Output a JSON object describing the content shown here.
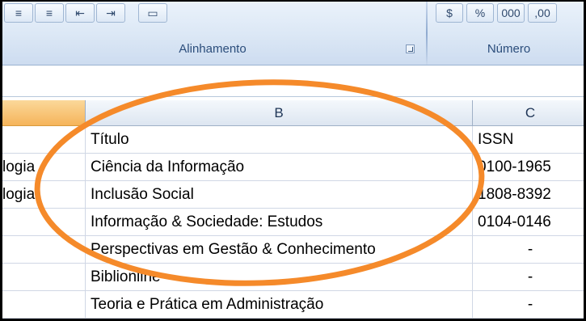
{
  "ribbon": {
    "groups": {
      "alignment_label": "Alinhamento",
      "number_label": "Número"
    }
  },
  "sheet": {
    "columns": [
      "B",
      "C"
    ],
    "rows": [
      {
        "a": "",
        "b": "Título",
        "c": "ISSN"
      },
      {
        "a": "logia",
        "b": "Ciência da Informação",
        "c": "0100-1965"
      },
      {
        "a": "logia",
        "b": "Inclusão Social",
        "c": "1808-8392"
      },
      {
        "a": "",
        "b": "Informação & Sociedade: Estudos",
        "c": "0104-0146"
      },
      {
        "a": "",
        "b": "Perspectivas em Gestão & Conhecimento",
        "c": "-"
      },
      {
        "a": "",
        "b": "Biblionline",
        "c": "-"
      },
      {
        "a": "",
        "b": "Teoria e Prática em Administração",
        "c": "-"
      }
    ]
  },
  "annotation": {
    "color": "#f58a2a",
    "shape": "ellipse"
  }
}
